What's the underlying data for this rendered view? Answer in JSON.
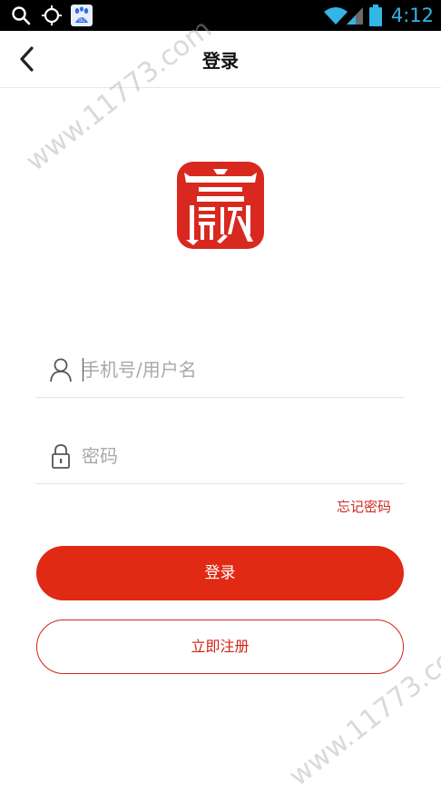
{
  "status_bar": {
    "time": "4:12",
    "icons": [
      "search-icon",
      "gps-icon",
      "baidu-app-icon",
      "wifi-icon",
      "signal-icon",
      "battery-icon"
    ],
    "time_color": "#33b5e5"
  },
  "header": {
    "title": "登录",
    "back_icon": "chevron-left-icon"
  },
  "logo": {
    "glyph": "赢",
    "color": "#d9281f"
  },
  "form": {
    "username_placeholder": "手机号/用户名",
    "password_placeholder": "密码",
    "forgot_password": "忘记密码"
  },
  "buttons": {
    "login": "登录",
    "register": "立即注册"
  },
  "watermark": {
    "text": "www.11773.com"
  },
  "colors": {
    "primary": "#e02a14",
    "text_red": "#cc2a1f"
  }
}
